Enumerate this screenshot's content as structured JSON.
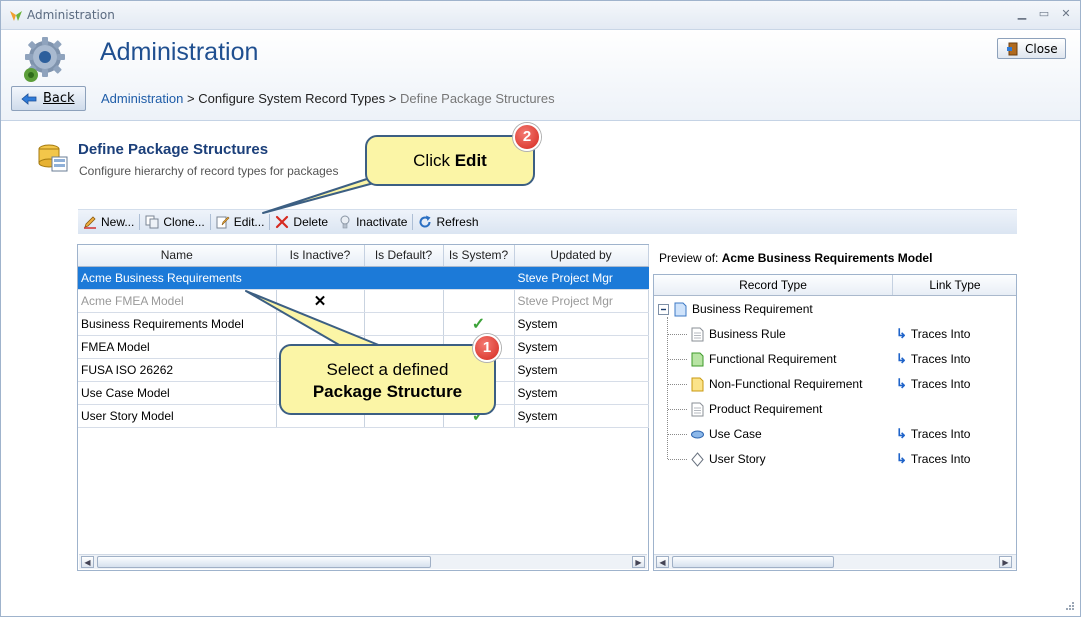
{
  "window": {
    "title": "Administration"
  },
  "header": {
    "title": "Administration",
    "close_label": "Close",
    "back_label": "Back",
    "breadcrumb": {
      "link": "Administration",
      "sep1": ">",
      "middle": "Configure System Record Types",
      "sep2": ">",
      "current": "Define Package Structures"
    }
  },
  "section": {
    "title": "Define Package Structures",
    "subtitle": "Configure hierarchy of record types for packages"
  },
  "toolbar": {
    "new": "New...",
    "clone": "Clone...",
    "edit": "Edit...",
    "delete": "Delete",
    "inactivate": "Inactivate",
    "refresh": "Refresh"
  },
  "grid": {
    "columns": [
      "Name",
      "Is Inactive?",
      "Is Default?",
      "Is System?",
      "Updated by"
    ],
    "rows": [
      {
        "name": "Acme Business Requirements",
        "inactive": "",
        "default": "",
        "system": "",
        "updated_by": "Steve Project Mgr"
      },
      {
        "name": "Acme FMEA Model",
        "inactive": "✕",
        "default": "",
        "system": "",
        "updated_by": "Steve Project Mgr"
      },
      {
        "name": "Business Requirements Model",
        "inactive": "",
        "default": "",
        "system": "✓",
        "updated_by": "System"
      },
      {
        "name": "FMEA Model",
        "inactive": "",
        "default": "",
        "system": "",
        "updated_by": "System"
      },
      {
        "name": "FUSA ISO 26262",
        "inactive": "",
        "default": "",
        "system": "",
        "updated_by": "System"
      },
      {
        "name": "Use Case Model",
        "inactive": "",
        "default": "",
        "system": "",
        "updated_by": "System"
      },
      {
        "name": "User Story Model",
        "inactive": "",
        "default": "",
        "system": "✓",
        "updated_by": "System"
      }
    ]
  },
  "preview": {
    "label": "Preview of:",
    "model": "Acme Business Requirements Model",
    "columns": [
      "Record Type",
      "Link Type"
    ],
    "root": "Business Requirement",
    "children": [
      {
        "label": "Business Rule",
        "link": "Traces Into",
        "icon": "document-icon"
      },
      {
        "label": "Functional Requirement",
        "link": "Traces Into",
        "icon": "green-document-icon"
      },
      {
        "label": "Non-Functional Requirement",
        "link": "Traces Into",
        "icon": "yellow-document-icon"
      },
      {
        "label": "Product Requirement",
        "link": "",
        "icon": "document-icon"
      },
      {
        "label": "Use Case",
        "link": "Traces Into",
        "icon": "ellipse-icon"
      },
      {
        "label": "User Story",
        "link": "Traces Into",
        "icon": "diamond-icon"
      }
    ]
  },
  "callouts": {
    "edit": {
      "prefix": "Click ",
      "bold": "Edit",
      "badge": "2"
    },
    "select": {
      "line1": "Select a defined",
      "line2": "Package Structure",
      "badge": "1"
    }
  },
  "colors": {
    "selection": "#1c7ad8",
    "title": "#1f4f90",
    "callout_fill": "#fbf5a6",
    "badge": "#d4281e"
  }
}
